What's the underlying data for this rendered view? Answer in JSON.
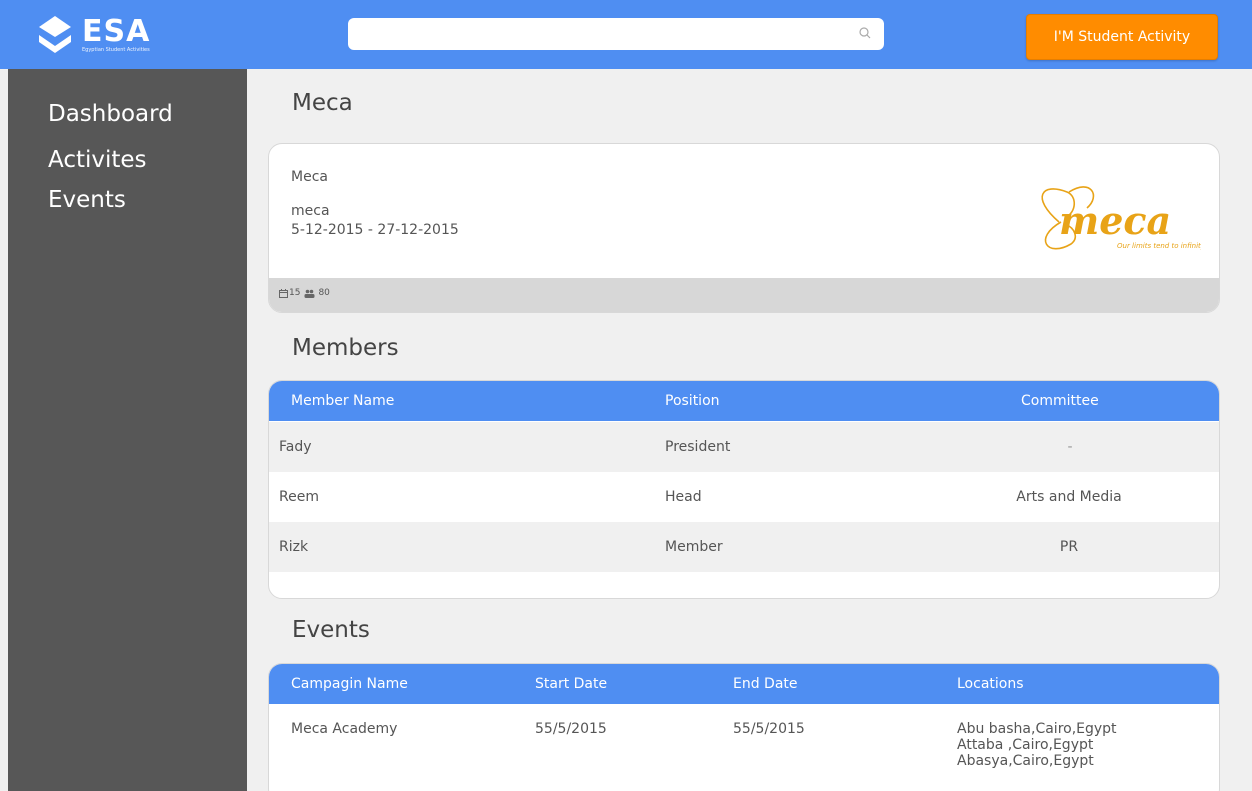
{
  "header": {
    "logo_text": "ESA",
    "logo_subtext": "Egyptian Student Activities",
    "search": {
      "value": "",
      "placeholder": ""
    },
    "cta_label": "I'M Student Activity"
  },
  "sidebar": {
    "items": [
      {
        "label": "Dashboard"
      },
      {
        "label": "Activites"
      },
      {
        "label": "Events"
      }
    ]
  },
  "page": {
    "title": "Meca",
    "card": {
      "name": "Meca",
      "subtitle": "meca",
      "dates": "5-12-2015 -  27-12-2015",
      "logo_text": "meca",
      "logo_tagline": "Our limits tend to infinity",
      "stat_calendar": "15",
      "stat_members": "80"
    }
  },
  "members": {
    "title": "Members",
    "columns": [
      "Member Name",
      "Position",
      "Committee"
    ],
    "rows": [
      {
        "name": "Fady",
        "position": "President",
        "committee": "-"
      },
      {
        "name": "Reem",
        "position": "Head",
        "committee": "Arts and Media"
      },
      {
        "name": "Rizk",
        "position": "Member",
        "committee": "PR"
      }
    ]
  },
  "events": {
    "title": "Events",
    "columns": [
      "Campagin Name",
      "Start Date",
      "End Date",
      "Locations"
    ],
    "rows": [
      {
        "name": "Meca Academy",
        "start": "55/5/2015",
        "end": "55/5/2015",
        "locations": [
          "Abu basha,Cairo,Egypt",
          "Attaba ,Cairo,Egypt",
          "Abasya,Cairo,Egypt"
        ]
      }
    ]
  },
  "colors": {
    "primary": "#4f8ef2",
    "accent": "#ff8c00",
    "sidebar": "#575757",
    "background": "#f0f0f0",
    "logo_orange": "#e8a317"
  }
}
